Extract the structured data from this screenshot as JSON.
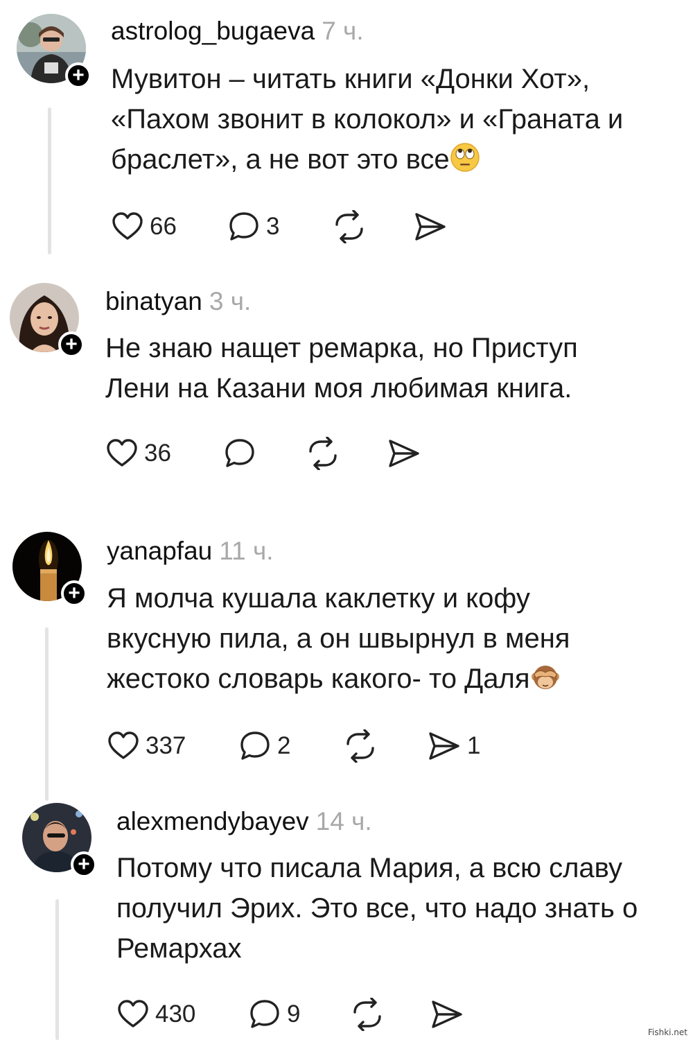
{
  "posts": [
    {
      "username": "astrolog_bugaeva",
      "time": "7 ч.",
      "text_lines": [
        "Мувитон – читать книги «Донки Хот»,",
        "«Пахом звонит в колокол» и «Граната и",
        "браслет», а не вот это все"
      ],
      "emoji": "face-with-rolling-eyes",
      "likes": "66",
      "comments": "3",
      "reposts": "",
      "shares": ""
    },
    {
      "username": "binatyan",
      "time": "3 ч.",
      "text_lines": [
        "Не знаю нащет ремарка, но Приступ",
        "Лени на Казани моя любимая книга."
      ],
      "likes": "36",
      "comments": "",
      "reposts": "",
      "shares": ""
    },
    {
      "username": "yanapfau",
      "time": "11 ч.",
      "text_lines": [
        "Я молча кушала каклетку и кофу",
        "вкусную пила, а он швырнул в меня",
        "жестоко словарь какого- то Даля"
      ],
      "emoji": "see-no-evil-monkey",
      "likes": "337",
      "comments": "2",
      "reposts": "",
      "shares": "1"
    },
    {
      "username": "alexmendybayev",
      "time": "14 ч.",
      "text_lines": [
        "Потому что писала Мария, а всю славу",
        "получил Эрих. Это все, что надо знать о",
        "Ремархах"
      ],
      "likes": "430",
      "comments": "9",
      "reposts": "",
      "shares": ""
    }
  ],
  "follow_symbol": "+",
  "watermark": "Fishki.net",
  "colors": {
    "text": "#1a1a1a",
    "time": "#a8a8a8",
    "thread_line": "#e3e3e3",
    "badge": "#000000"
  }
}
